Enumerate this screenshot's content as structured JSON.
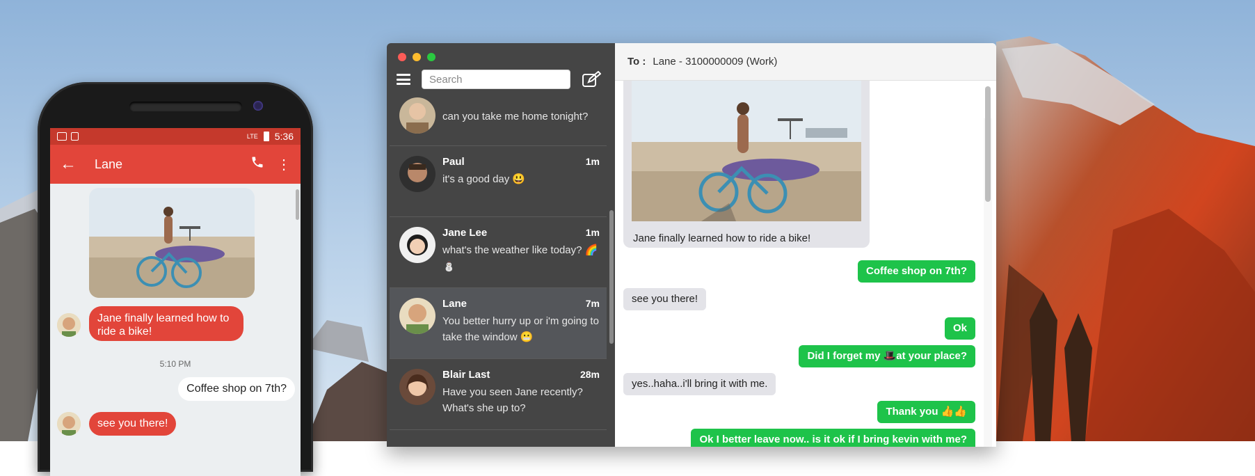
{
  "phone": {
    "status_time": "5:36",
    "status_signal": "LTE",
    "contact_name": "Lane",
    "messages": [
      {
        "text": "Jane finally learned how to ride a bike!",
        "direction": "in"
      },
      {
        "text": "5:10 PM",
        "direction": "time"
      },
      {
        "text": "Coffee shop on 7th?",
        "direction": "out"
      },
      {
        "text": "see you there!",
        "direction": "in"
      }
    ]
  },
  "mac": {
    "search_placeholder": "Search",
    "conversations": [
      {
        "name": "",
        "time": "",
        "preview": "can you take me home tonight?"
      },
      {
        "name": "Paul",
        "time": "1m",
        "preview": "it's a good day 😃"
      },
      {
        "name": "Jane Lee",
        "time": "1m",
        "preview": "what's the weather like today? 🌈⛄"
      },
      {
        "name": "Lane",
        "time": "7m",
        "preview": "You better hurry up or i'm going to take the window 😬"
      },
      {
        "name": "Blair Last",
        "time": "28m",
        "preview": "Have you seen Jane recently? What's she up to?"
      }
    ],
    "chat": {
      "to_label": "To :",
      "to_value": "Lane - 3100000009 (Work)",
      "photo_caption": "Jane finally learned how to ride a bike!",
      "messages": [
        {
          "text": "Coffee shop on 7th?",
          "direction": "out"
        },
        {
          "text": "see you there!",
          "direction": "in"
        },
        {
          "text": "Ok",
          "direction": "out"
        },
        {
          "text": "Did I forget my 🎩at your place?",
          "direction": "out"
        },
        {
          "text": "yes..haha..i'll bring it with me.",
          "direction": "in"
        },
        {
          "text": "Thank you 👍👍",
          "direction": "out"
        },
        {
          "text": "Ok I better leave now.. is it ok if I bring kevin with me?",
          "direction": "out"
        }
      ]
    }
  },
  "colors": {
    "phone_appbar": "#e2453a",
    "phone_statusbar": "#c5392c",
    "mac_sidebar": "#454545",
    "bubble_out_green": "#1ec34a",
    "bubble_in_gray": "#e3e3e8"
  }
}
